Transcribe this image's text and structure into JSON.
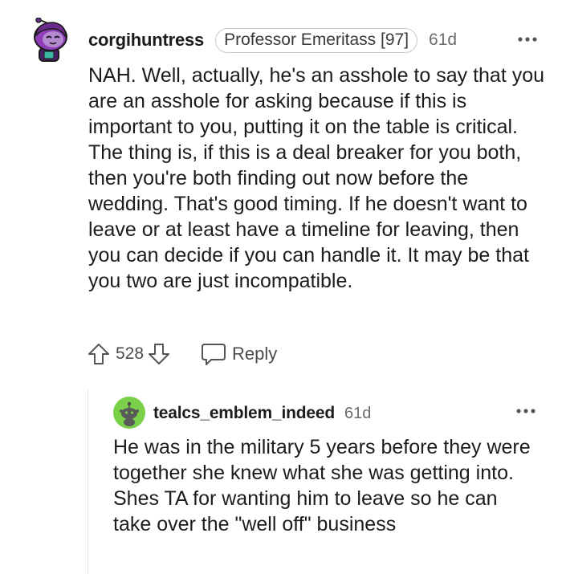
{
  "comment": {
    "author": "corgihuntress",
    "flair": "Professor Emeritass [97]",
    "age": "61d",
    "body": "NAH. Well, actually, he's an asshole to say that you are an asshole for asking because if this is important to you, putting it on the table is critical. The thing is, if this is a deal breaker for you both, then you're both finding out now before the wedding. That's good timing. If he doesn't want to leave or at least have a timeline for leaving, then you can decide if you can handle it. It may be that you two are just incompatible.",
    "score": "528",
    "reply_label": "Reply",
    "avatar_color": "#6a2a8c"
  },
  "reply": {
    "author": "tealcs_emblem_indeed",
    "age": "61d",
    "body": "He was in the military 5 years before they were together she knew what she was getting into. Shes TA for wanting him to leave so he can take over the \"well off\" business",
    "avatar_color": "#7bd04a"
  },
  "icons": {
    "upvote": "arrow-up-icon",
    "downvote": "arrow-down-icon",
    "reply": "speech-bubble-icon",
    "more": "ellipsis-icon"
  }
}
